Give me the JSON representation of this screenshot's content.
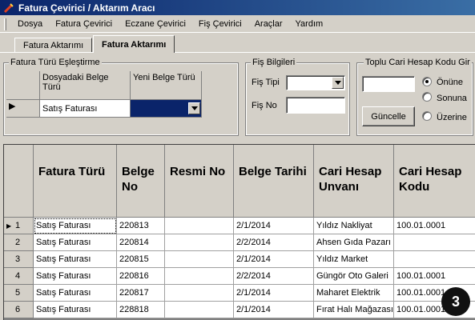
{
  "window": {
    "title": "Fatura Çevirici / Aktarım Aracı"
  },
  "menu": [
    "Dosya",
    "Fatura Çevirici",
    "Eczane Çevirici",
    "Fiş Çevirici",
    "Araçlar",
    "Yardım"
  ],
  "tabs": [
    {
      "label": "Fatura Aktarımı"
    },
    {
      "label": "Fatura Aktarımı"
    }
  ],
  "fatura_turu_group": {
    "title": "Fatura Türü Eşleştirme",
    "col1": "Dosyadaki Belge Türü",
    "col2": "Yeni Belge Türü",
    "row_value": "Satış Faturası"
  },
  "fis_bilgileri": {
    "title": "Fiş Bilgileri",
    "fis_tipi_label": "Fiş Tipi",
    "fis_no_label": "Fiş No",
    "fis_tipi_value": "",
    "fis_no_value": ""
  },
  "toplu_cari": {
    "title": "Toplu Cari Hesap Kodu Gir",
    "input_value": "",
    "button": "Güncelle",
    "radios": [
      {
        "label": "Önüne",
        "checked": true
      },
      {
        "label": "Sonuna",
        "checked": false
      },
      {
        "label": "Üzerine",
        "checked": false
      }
    ]
  },
  "grid": {
    "columns": [
      "Fatura Türü",
      "Belge No",
      "Resmi No",
      "Belge Tarihi",
      "Cari Hesap Unvanı",
      "Cari Hesap Kodu"
    ],
    "rows": [
      {
        "n": "1",
        "tur": "Satış Faturası",
        "belge_no": "220813",
        "resmi_no": "",
        "tarih": "2/1/2014",
        "unvan": "Yıldız Nakliyat",
        "kod": "100.01.0001"
      },
      {
        "n": "2",
        "tur": "Satış Faturası",
        "belge_no": "220814",
        "resmi_no": "",
        "tarih": "2/2/2014",
        "unvan": "Ahsen Gıda Pazarı",
        "kod": ""
      },
      {
        "n": "3",
        "tur": "Satış Faturası",
        "belge_no": "220815",
        "resmi_no": "",
        "tarih": "2/1/2014",
        "unvan": "Yıldız Market",
        "kod": ""
      },
      {
        "n": "4",
        "tur": "Satış Faturası",
        "belge_no": "220816",
        "resmi_no": "",
        "tarih": "2/2/2014",
        "unvan": "Güngör Oto Galeri",
        "kod": "100.01.0001"
      },
      {
        "n": "5",
        "tur": "Satış Faturası",
        "belge_no": "220817",
        "resmi_no": "",
        "tarih": "2/1/2014",
        "unvan": "Maharet Elektrik",
        "kod": "100.01.0001"
      },
      {
        "n": "6",
        "tur": "Satış Faturası",
        "belge_no": "228818",
        "resmi_no": "",
        "tarih": "2/1/2014",
        "unvan": "Fırat Halı Mağazası",
        "kod": "100.01.0001"
      }
    ]
  },
  "badge": "3",
  "colors": {
    "title_start": "#0a246a",
    "title_end": "#3a6ea5",
    "selected_cell": "#0a246a",
    "face": "#d4d0c8"
  }
}
